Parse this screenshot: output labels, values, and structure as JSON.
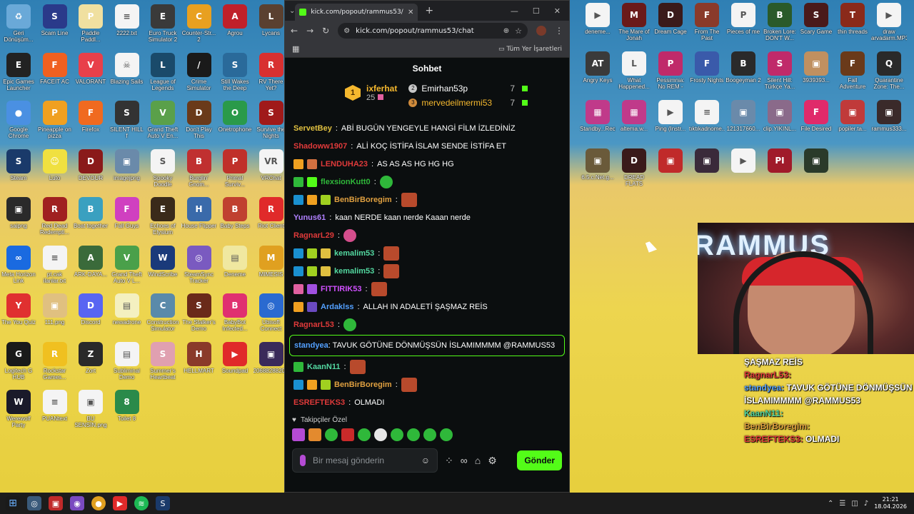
{
  "desktop": {
    "left_icons": [
      {
        "label": "Geri Dönüşüm...",
        "color": "#6aa9d8",
        "glyph": "♻"
      },
      {
        "label": "Scam Line",
        "color": "#2a3a8a",
        "glyph": "S"
      },
      {
        "label": "Paddle Paddl...",
        "color": "#f0e0a0",
        "glyph": "P"
      },
      {
        "label": "2222.txt",
        "color": "#f4f4f4",
        "glyph": "≡"
      },
      {
        "label": "Euro Truck Simulator 2",
        "color": "#3a3a3a",
        "glyph": "E"
      },
      {
        "label": "Counter-Str... 2",
        "color": "#e8a020",
        "glyph": "C"
      },
      {
        "label": "Agrou",
        "color": "#c0202a",
        "glyph": "A"
      },
      {
        "label": "Lycans",
        "color": "#5a4030",
        "glyph": "L"
      },
      {
        "label": "Epic Games Launcher",
        "color": "#222222",
        "glyph": "E"
      },
      {
        "label": "FACEIT AC",
        "color": "#f06020",
        "glyph": "F"
      },
      {
        "label": "VALORANT",
        "color": "#e8404a",
        "glyph": "V"
      },
      {
        "label": "Blazing Sails",
        "color": "#f4f4f4",
        "glyph": "☠"
      },
      {
        "label": "League of Legends",
        "color": "#1a4a6a",
        "glyph": "L"
      },
      {
        "label": "Crime Simulator",
        "color": "#1a1a1a",
        "glyph": "/"
      },
      {
        "label": "Still Wakes the Deep",
        "color": "#2a6a9a",
        "glyph": "S"
      },
      {
        "label": "RV There Yet?",
        "color": "#d83030",
        "glyph": "R"
      },
      {
        "label": "Google Chrome",
        "color": "#4a90e2",
        "glyph": "●"
      },
      {
        "label": "Pineapple on pizza",
        "color": "#f0a020",
        "glyph": "P"
      },
      {
        "label": "Firefox",
        "color": "#f06a20",
        "glyph": "F"
      },
      {
        "label": "SILENT HILL f",
        "color": "#333333",
        "glyph": "S"
      },
      {
        "label": "Grand Theft Auto V En...",
        "color": "#5aa04a",
        "glyph": "V"
      },
      {
        "label": "Don't Play This",
        "color": "#6a3a1a",
        "glyph": "D"
      },
      {
        "label": "Onetrophone",
        "color": "#2a9a4a",
        "glyph": "O"
      },
      {
        "label": "Survive the Nights",
        "color": "#a01a1a",
        "glyph": "S"
      },
      {
        "label": "Steam",
        "color": "#1a3a6a",
        "glyph": "S"
      },
      {
        "label": "Luto",
        "color": "#f0e040",
        "glyph": "☺"
      },
      {
        "label": "DEVOUR",
        "color": "#8a1a1a",
        "glyph": "D"
      },
      {
        "label": "imagejpng",
        "color": "#6a8aaa",
        "glyph": "▣"
      },
      {
        "label": "Spooky Doodle",
        "color": "#f4f4f4",
        "glyph": "S"
      },
      {
        "label": "Burglin' Gnom...",
        "color": "#c03030",
        "glyph": "B"
      },
      {
        "label": "Primal Surviv...",
        "color": "#c0302a",
        "glyph": "P"
      },
      {
        "label": "VRChat",
        "color": "#f4f4f4",
        "glyph": "VR"
      },
      {
        "label": "saipng",
        "color": "#2a2a2a",
        "glyph": "▣"
      },
      {
        "label": "Red Dead Redempti...",
        "color": "#a02020",
        "glyph": "R"
      },
      {
        "label": "Boat together",
        "color": "#3aa0c0",
        "glyph": "B"
      },
      {
        "label": "Fall Guys",
        "color": "#d040c0",
        "glyph": "F"
      },
      {
        "label": "Echoes of Elysium",
        "color": "#3a2a1a",
        "glyph": "E"
      },
      {
        "label": "House Flipper",
        "color": "#3a6aaa",
        "glyph": "H"
      },
      {
        "label": "Baby Steps",
        "color": "#c04030",
        "glyph": "B"
      },
      {
        "label": "Riot Client",
        "color": "#e02a2a",
        "glyph": "R"
      },
      {
        "label": "Meta Horizon Link",
        "color": "#1a6ae0",
        "glyph": "∞"
      },
      {
        "label": "pt.cak ilanlar.txt",
        "color": "#f4f4f4",
        "glyph": "≡"
      },
      {
        "label": "ARK-DAYA...",
        "color": "#3a6a3a",
        "glyph": "A"
      },
      {
        "label": "Grand Theft Auto V L...",
        "color": "#4aa04a",
        "glyph": "V"
      },
      {
        "label": "WindScribe",
        "color": "#1a3a7a",
        "glyph": "W"
      },
      {
        "label": "SteamSync Tracker",
        "color": "#7a5ac0",
        "glyph": "◎"
      },
      {
        "label": "Deneme",
        "color": "#f0e8a0",
        "glyph": "▤"
      },
      {
        "label": "MIMESIS",
        "color": "#e0a020",
        "glyph": "M"
      },
      {
        "label": "The You Quiz",
        "color": "#e03030",
        "glyph": "Y"
      },
      {
        "label": "111.png",
        "color": "#e0c080",
        "glyph": "▣"
      },
      {
        "label": "Discord",
        "color": "#5865f2",
        "glyph": "D"
      },
      {
        "label": "newadrone",
        "color": "#f4f0c0",
        "glyph": "▤"
      },
      {
        "label": "Construction Simulator",
        "color": "#5a8aaa",
        "glyph": "C"
      },
      {
        "label": "The Stalker's Demo",
        "color": "#6a2a1a",
        "glyph": "S"
      },
      {
        "label": "BabyBot Infected...",
        "color": "#e03070",
        "glyph": "B"
      },
      {
        "label": "Ubisoft Connect",
        "color": "#2a6ad0",
        "glyph": "◎"
      },
      {
        "label": "Logitech G HUB",
        "color": "#1a1a1a",
        "glyph": "G"
      },
      {
        "label": "Rockstar Games...",
        "color": "#f0c020",
        "glyph": "R"
      },
      {
        "label": "Zort",
        "color": "#2a2a2a",
        "glyph": "Z"
      },
      {
        "label": "Subliminal Demo",
        "color": "#f4f4f4",
        "glyph": "▤"
      },
      {
        "label": "Summer's Heartbeat",
        "color": "#e0a0b0",
        "glyph": "S"
      },
      {
        "label": "HELLMART",
        "color": "#8a3a2a",
        "glyph": "H"
      },
      {
        "label": "Soundpad",
        "color": "#e02a2a",
        "glyph": "▶"
      },
      {
        "label": "2068828820...",
        "color": "#3a2a5a",
        "glyph": "▣"
      },
      {
        "label": "Werewolf Party",
        "color": "#1a1a2a",
        "glyph": "W"
      },
      {
        "label": "PUANtext",
        "color": "#f4f4f4",
        "glyph": "≡"
      },
      {
        "label": "BU SENSİN.png",
        "color": "#f4f4f4",
        "glyph": "▣"
      },
      {
        "label": "Toilet 8",
        "color": "#2a8a4a",
        "glyph": "8"
      }
    ],
    "right_icons": [
      {
        "label": "deneme...",
        "color": "#f4f4f4",
        "glyph": "▶"
      },
      {
        "label": "The Mare of Jonah",
        "color": "#6a1a1a",
        "glyph": "M"
      },
      {
        "label": "Dream Cage",
        "color": "#3a1a1a",
        "glyph": "D"
      },
      {
        "label": "From The Past",
        "color": "#8a3a2a",
        "glyph": "F"
      },
      {
        "label": "Pieces of me",
        "color": "#f4f4f4",
        "glyph": "P"
      },
      {
        "label": "Broken Lore: DON'T W...",
        "color": "#2a5a2a",
        "glyph": "B"
      },
      {
        "label": "Scary Game",
        "color": "#4a1a1a",
        "glyph": "S"
      },
      {
        "label": "thin threads",
        "color": "#8a2a1a",
        "glyph": "T"
      },
      {
        "label": "draw arvadarm.MP3",
        "color": "#f4f4f4",
        "glyph": "▶"
      },
      {
        "label": "Angry Keys",
        "color": "#3a3a3a",
        "glyph": "AT"
      },
      {
        "label": "What Happened...",
        "color": "#f4f4f4",
        "glyph": "L"
      },
      {
        "label": "Pessimnia: No REM - Fi...",
        "color": "#c02a6a",
        "glyph": "P"
      },
      {
        "label": "Frosty Nights",
        "color": "#3a5aaa",
        "glyph": "F"
      },
      {
        "label": "Boogeyman 2",
        "color": "#2a2a2a",
        "glyph": "B"
      },
      {
        "label": "Silent Hill: Türkçe Ya...",
        "color": "#c02a6a",
        "glyph": "S"
      },
      {
        "label": "3939393...",
        "color": "#c09060",
        "glyph": "▣"
      },
      {
        "label": "Fall Adventure",
        "color": "#6a3a1a",
        "glyph": "F"
      },
      {
        "label": "Quarantine Zone: The...",
        "color": "#2a2a2a",
        "glyph": "Q"
      },
      {
        "label": "Standby...Record...zip",
        "color": "#c03a8a",
        "glyph": "▦"
      },
      {
        "label": "altema.w...",
        "color": "#c03a8a",
        "glyph": "▦"
      },
      {
        "label": "Ping (Instr...",
        "color": "#f4f4f4",
        "glyph": "▶"
      },
      {
        "label": "tıktıkadnome...",
        "color": "#f4f4f4",
        "glyph": "≡"
      },
      {
        "label": "121317660...",
        "color": "#6a8aaa",
        "glyph": "▣"
      },
      {
        "label": "clip.YIKINL...",
        "color": "#8a6a8a",
        "glyph": "▣"
      },
      {
        "label": "File Desired",
        "color": "#e02a6a",
        "glyph": "F"
      },
      {
        "label": "popiler.ta...",
        "color": "#c03a3a",
        "glyph": "▣"
      },
      {
        "label": "rammus333...",
        "color": "#3a2a2a",
        "glyph": "▣"
      },
      {
        "label": "6.5.c.Net.g...",
        "color": "#6a5a3a",
        "glyph": "▣"
      },
      {
        "label": "DREAD FLATS",
        "color": "#3a1a1a",
        "glyph": "D"
      },
      {
        "label": "",
        "color": "#c02a2a",
        "glyph": "▣"
      },
      {
        "label": "",
        "color": "#3a2a3a",
        "glyph": "▣"
      },
      {
        "label": "",
        "color": "#f4f4f4",
        "glyph": "▶"
      },
      {
        "label": "",
        "color": "#a01a2a",
        "glyph": "PI"
      },
      {
        "label": "",
        "color": "#2a3a2a",
        "glyph": "▣"
      }
    ]
  },
  "browser": {
    "tab_title": "kick.com/popout/rammus53/ch",
    "url": "kick.com/popout/rammus53/chat",
    "all_bookmarks": "Tüm Yer İşaretleri",
    "chat_title": "Sohbet",
    "leaderboard": {
      "first": {
        "name": "ixferhat",
        "count": "25"
      },
      "rows": [
        {
          "name": "Emirhan53p",
          "count": "7"
        },
        {
          "name": "mervedeilmermi53",
          "count": "7"
        }
      ],
      "first_rank": "1"
    },
    "messages": [
      {
        "user": "ServetBey",
        "color": "#e0c040",
        "text": "ABİ BUGÜN YENGEYLE HANGİ FİLM İZLEDİNİZ",
        "icons": []
      },
      {
        "user": "Shadoww1907",
        "color": "#e03a3a",
        "text": "ALİ KOÇ İSTİFA İSLAM SENDE İSTİFA ET",
        "icons": []
      },
      {
        "user": "LENDUHA23",
        "color": "#e03a3a",
        "text": "AS AS AS HG HG HG",
        "icons": [
          "#f0a020",
          "#d07040"
        ]
      },
      {
        "user": "flexsionKutt0",
        "color": "#2fb83a",
        "text": "",
        "icons": [
          "#2fb83a",
          "#53fc18"
        ],
        "emote": "green"
      },
      {
        "user": "BenBirBoregim",
        "color": "#e0a040",
        "text": "",
        "icons": [
          "#1a90d0",
          "#f0a020",
          "#a0d020"
        ],
        "emote": "red"
      },
      {
        "user": "Yunus61",
        "color": "#b080ff",
        "text": "kaan NERDE kaan nerde Kaaan nerde",
        "icons": []
      },
      {
        "user": "RagnarL29",
        "color": "#e03a3a",
        "text": "",
        "icons": [],
        "emote": "pink"
      },
      {
        "user": "kemalim53",
        "color": "#53d8a0",
        "text": "",
        "icons": [
          "#1a90d0",
          "#a0d020",
          "#e0c040"
        ],
        "emote": "red"
      },
      {
        "user": "kemalim53",
        "color": "#53d8a0",
        "text": "",
        "icons": [
          "#1a90d0",
          "#a0d020",
          "#e0c040"
        ],
        "emote": "red"
      },
      {
        "user": "FITTIRIK53",
        "color": "#d050ff",
        "text": "",
        "icons": [
          "#e060a0",
          "#a050e0"
        ],
        "emote": "red"
      },
      {
        "user": "Ardaklss",
        "color": "#53a0ff",
        "text": "ALLAH IN ADALETİ ŞAŞMAZ REİS",
        "icons": [
          "#f0a020",
          "#6a4ac0"
        ]
      },
      {
        "user": "RagnarL53",
        "color": "#e03a3a",
        "text": "",
        "icons": [],
        "emote": "green"
      }
    ],
    "highlight": {
      "user": "standyea",
      "text": "TAVUK GÖTÜNE DÖNMÜŞSÜN İSLAMIMMMM @RAMMUS53"
    },
    "messages_after": [
      {
        "user": "KaanN11",
        "color": "#53d8a0",
        "text": "",
        "icons": [
          "#2fb83a"
        ],
        "emote": "red"
      },
      {
        "user": "BenBirBoregim",
        "color": "#e0a040",
        "text": "",
        "icons": [
          "#1a90d0",
          "#f0a020",
          "#a0d020"
        ],
        "emote": "red"
      },
      {
        "user": "ESREFTEKS3",
        "color": "#e03a3a",
        "text": "OLMADI",
        "icons": []
      }
    ],
    "emote_tabs": "Takipçiler Özel",
    "input_placeholder": "Bir mesaj gönderin",
    "send_label": "Gönder"
  },
  "stream_overlay": {
    "brand": "RAMMUS",
    "lines": [
      {
        "user": "",
        "text": "ŞAŞMAZ REİS",
        "color": "#ffffff"
      },
      {
        "user": "RagnarL53:",
        "text": "",
        "color": "#e03a3a"
      },
      {
        "user": "standyea:",
        "text": "TAVUK GÖTÜNE DÖNMÜŞSÜN İSLAMIMMMM @RAMMUS53",
        "color": "#53a0ff"
      },
      {
        "user": "KaanN11:",
        "text": "",
        "color": "#53d8a0"
      },
      {
        "user": "BenBirBoregim:",
        "text": "",
        "color": "#e0a040"
      },
      {
        "user": "ESREFTEKS3:",
        "text": "OLMADI",
        "color": "#e03a3a"
      }
    ]
  },
  "taskbar": {
    "time": "21:21",
    "date": "18.04.2026"
  }
}
